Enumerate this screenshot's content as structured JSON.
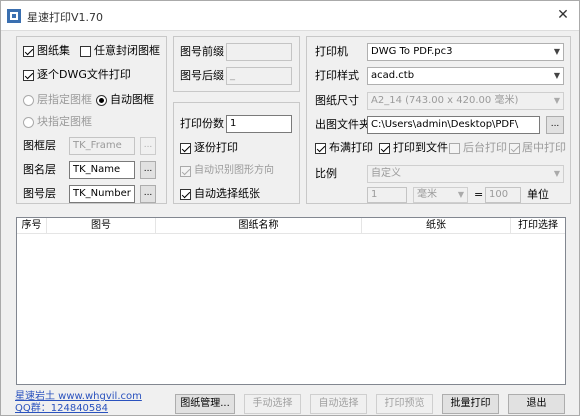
{
  "window": {
    "title": "星速打印V1.70"
  },
  "left": {
    "chk_drawing_set": "图纸集",
    "chk_any_closed_frame": "任意封闭图框",
    "chk_each_dwg": "逐个DWG文件打印",
    "radio_layer_frame": "层指定图框",
    "radio_auto_frame": "自动图框",
    "radio_block_frame": "块指定图框",
    "frame_layer_label": "图框层",
    "frame_layer_value": "TK_Frame",
    "name_layer_label": "图名层",
    "name_layer_value": "TK_Name",
    "number_layer_label": "图号层",
    "number_layer_value": "TK_Number",
    "browse": "..."
  },
  "middle": {
    "prefix_label": "图号前缀",
    "prefix_value": "",
    "suffix_label": "图号后缀",
    "suffix_value": "_",
    "copies_label": "打印份数",
    "copies_value": "1",
    "chk_collate": "逐份打印",
    "chk_auto_orient": "自动识别图形方向",
    "chk_auto_paper": "自动选择纸张"
  },
  "right": {
    "printer_label": "打印机",
    "printer_value": "DWG To PDF.pc3",
    "style_label": "打印样式",
    "style_value": "acad.ctb",
    "size_label": "图纸尺寸",
    "size_value": "A2_14 (743.00 x 420.00 毫米)",
    "folder_label": "出图文件夹",
    "folder_value": "C:\\Users\\admin\\Desktop\\PDF\\",
    "browse": "...",
    "chk_fill": "布满打印",
    "chk_to_file": "打印到文件",
    "chk_background": "后台打印",
    "chk_center": "居中打印",
    "scale_label": "比例",
    "scale_value": "自定义",
    "scale_num": "1",
    "scale_unit": "毫米",
    "equals": "=",
    "scale_den": "100",
    "unit_label": "单位"
  },
  "table": {
    "columns": [
      "序号",
      "图号",
      "图纸名称",
      "纸张",
      "打印选择"
    ]
  },
  "footer": {
    "website": "星速岩土 www.whgvil.com",
    "qq": "QQ群：124840584",
    "btn_manage": "图纸管理...",
    "btn_manual": "手动选择",
    "btn_auto": "自动选择",
    "btn_preview": "打印预览",
    "btn_batch": "批量打印",
    "btn_exit": "退出"
  }
}
